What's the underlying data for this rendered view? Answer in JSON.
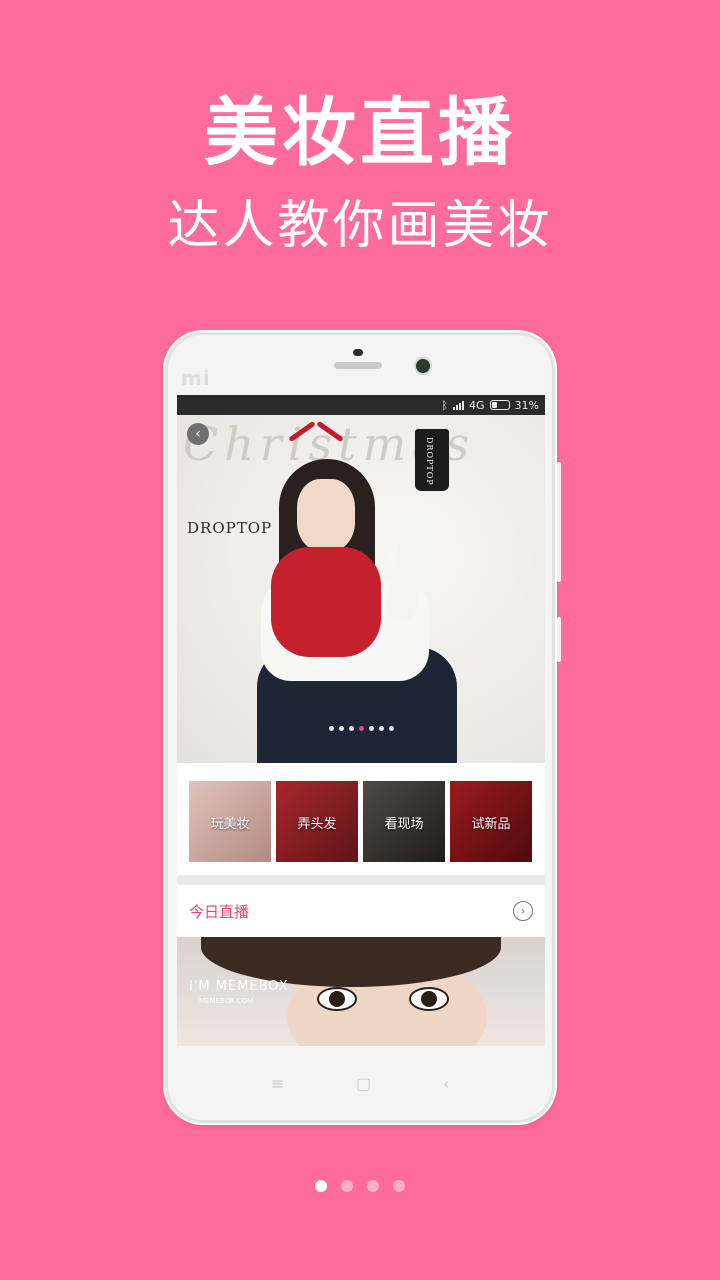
{
  "headline": "美妆直播",
  "subheadline": "达人教你画美妆",
  "device": {
    "brand_logo": "mi",
    "status": {
      "network": "4G",
      "battery": "31%"
    },
    "nav_keys": [
      "≡",
      "▢",
      "‹"
    ]
  },
  "banner": {
    "script_text": "Christmas",
    "brand_text": "DROPTOP",
    "cup_label": "DROPTOP",
    "dot_count": 7,
    "active_dot": 3
  },
  "categories": [
    {
      "label": "玩美妆",
      "color": "#caa39d"
    },
    {
      "label": "弄头发",
      "color": "#8f1f24"
    },
    {
      "label": "看现场",
      "color": "#3a3434"
    },
    {
      "label": "试新品",
      "color": "#7e1116"
    }
  ],
  "today": {
    "label": "今日直播",
    "arrow": "›"
  },
  "live_card": {
    "brand": "I'M MEMEBOX",
    "brand_url": "MEMEBOX.COM"
  },
  "pager": {
    "count": 4,
    "active": 0
  },
  "colors": {
    "background": "#ff6b9d",
    "accent": "#ee3f7c"
  }
}
